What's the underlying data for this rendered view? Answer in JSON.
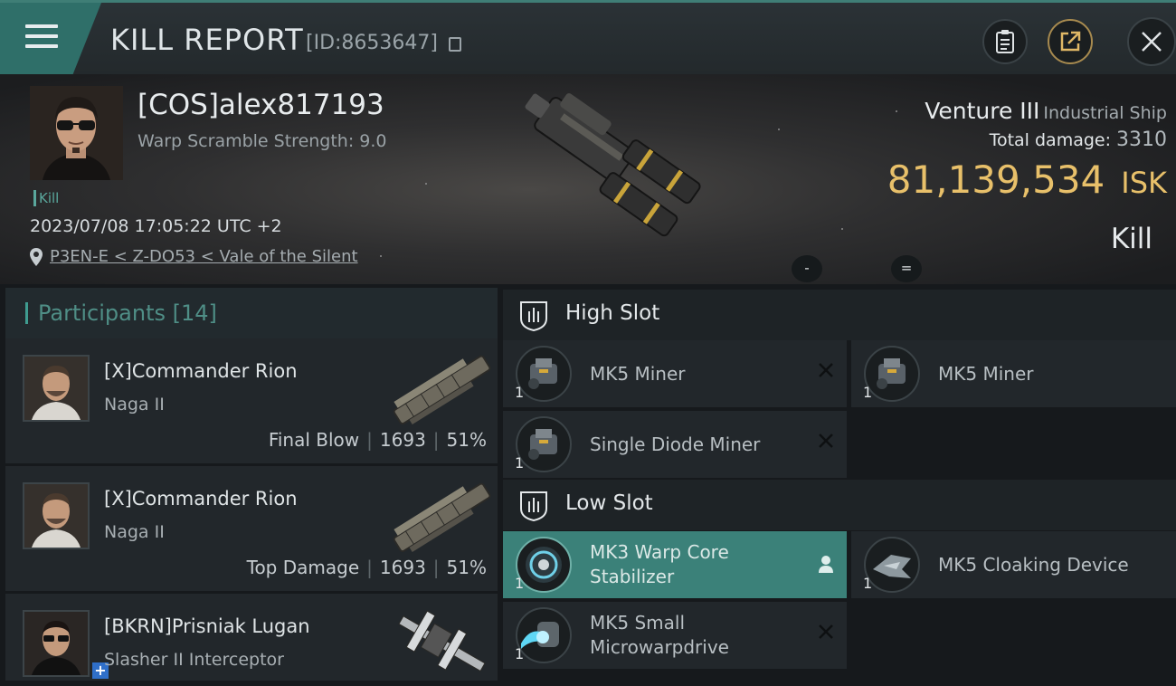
{
  "header": {
    "title": "KILL REPORT",
    "report_id": "[ID:8653647]"
  },
  "victim": {
    "name": "[COS]alex817193",
    "warp_scramble": "Warp Scramble Strength: 9.0",
    "kill_tag": "Kill",
    "timestamp": "2023/07/08 17:05:22 UTC +2",
    "location": "P3EN-E < Z-DO53 < Vale of the Silent",
    "ship_name": "Venture III",
    "ship_class": "Industrial Ship",
    "total_damage_label": "Total damage:",
    "total_damage": "3310",
    "isk_value": "81,139,534",
    "isk_unit": "ISK",
    "result": "Kill",
    "minus_label": "-",
    "equals_label": "="
  },
  "participants": {
    "label": "Participants",
    "count": "[14]",
    "items": [
      {
        "name": "[X]Commander Rion",
        "ship": "Naga II",
        "role": "Final Blow",
        "damage": "1693",
        "percent": "51%"
      },
      {
        "name": "[X]Commander Rion",
        "ship": "Naga II",
        "role": "Top Damage",
        "damage": "1693",
        "percent": "51%"
      },
      {
        "name": "[BKRN]Prisniak Lugan",
        "ship": "Slasher II Interceptor"
      }
    ]
  },
  "fitting": {
    "high_slot_label": "High Slot",
    "low_slot_label": "Low Slot",
    "high": [
      {
        "name": "MK5 Miner",
        "qty": "1"
      },
      {
        "name": "MK5 Miner",
        "qty": "1"
      },
      {
        "name": "Single Diode Miner",
        "qty": "1"
      }
    ],
    "low": [
      {
        "line1": "MK3 Warp Core",
        "line2": "Stabilizer",
        "qty": "1"
      },
      {
        "line1": "MK5 Cloaking Device",
        "qty": "1"
      },
      {
        "line1": "MK5 Small",
        "line2": "Microwarpdrive",
        "qty": "1"
      }
    ]
  },
  "colors": {
    "accent": "#3f9c90",
    "isk": "#e8c06a",
    "highlight_module": "#3b8179"
  }
}
